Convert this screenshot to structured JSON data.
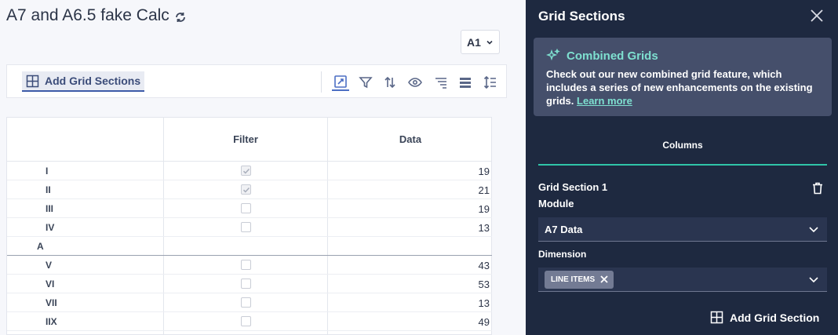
{
  "page": {
    "title": "A7 and A6.5 fake Calc",
    "page_selector": "A1"
  },
  "toolbar": {
    "add_grid_label": "Add Grid Sections",
    "icons": [
      "pivot-icon",
      "filter-icon",
      "sort-icon",
      "show-hide-icon",
      "format-icon",
      "row-height-icon",
      "column-height-icon"
    ]
  },
  "grid": {
    "columns": [
      "",
      "Filter",
      "Data"
    ],
    "rows": [
      {
        "label": "I",
        "checked": true,
        "value": "19",
        "group": false
      },
      {
        "label": "II",
        "checked": true,
        "value": "21",
        "group": false
      },
      {
        "label": "III",
        "checked": false,
        "value": "19",
        "group": false
      },
      {
        "label": "IV",
        "checked": false,
        "value": "13",
        "group": false
      },
      {
        "label": "A",
        "checked": null,
        "value": "",
        "group": true
      },
      {
        "label": "V",
        "checked": false,
        "value": "43",
        "group": false
      },
      {
        "label": "VI",
        "checked": false,
        "value": "53",
        "group": false
      },
      {
        "label": "VII",
        "checked": false,
        "value": "13",
        "group": false
      },
      {
        "label": "IIX",
        "checked": false,
        "value": "49",
        "group": false
      }
    ]
  },
  "panel": {
    "title": "Grid Sections",
    "banner": {
      "heading": "Combined Grids",
      "body": "Check out our new combined grid feature, which includes a series of new enhancements on the existing grids.",
      "link": "Learn more"
    },
    "tab": "Columns",
    "section_label": "Grid Section 1",
    "module_label": "Module",
    "module_value": "A7 Data",
    "dimension_label": "Dimension",
    "dimension_chip": "LINE ITEMS",
    "add_button": "Add Grid Section"
  },
  "colors": {
    "panel_bg": "#1e2940",
    "accent_teal": "#2fc4a8",
    "accent_blue": "#3d5ba8"
  }
}
